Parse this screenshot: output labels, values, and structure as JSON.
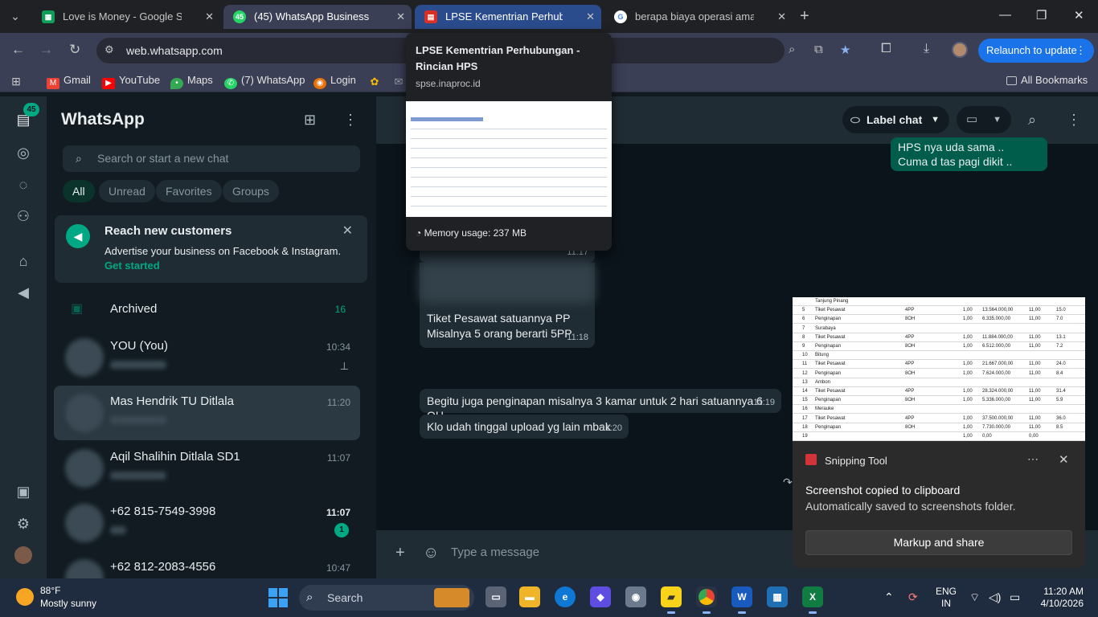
{
  "browser": {
    "tabs": [
      {
        "title": "Love is Money - Google Spread",
        "favicon": "sheets-icon",
        "state": "normal"
      },
      {
        "title": "(45) WhatsApp Business",
        "favicon": "whatsapp-icon",
        "favicon_text": "45",
        "state": "active"
      },
      {
        "title": "LPSE Kementrian Perhubungan",
        "favicon": "pdf-icon",
        "state": "hovered"
      },
      {
        "title": "berapa biaya operasi amandel",
        "favicon": "google-icon",
        "state": "normal"
      }
    ],
    "url": "web.whatsapp.com",
    "relaunch_label": "Relaunch to update",
    "bookmarks": [
      "Gmail",
      "YouTube",
      "Maps",
      "(7) WhatsApp",
      "Login"
    ],
    "all_bookmarks": "All Bookmarks"
  },
  "hover_card": {
    "title": "LPSE Kementrian Perhubungan - Rincian HPS",
    "domain": "spse.inaproc.id",
    "memory": "Memory usage: 237 MB"
  },
  "whatsapp": {
    "rail_badge": "45",
    "title": "WhatsApp",
    "search_placeholder": "Search or start a new chat",
    "filters": [
      "All",
      "Unread",
      "Favorites",
      "Groups"
    ],
    "promo": {
      "title": "Reach new customers",
      "desc": "Advertise your business on Facebook & Instagram.",
      "link": "Get started"
    },
    "archived": {
      "label": "Archived",
      "count": "16"
    },
    "chats": [
      {
        "name": "YOU (You)",
        "time": "10:34",
        "pinned": true,
        "unread": ""
      },
      {
        "name": "Mas Hendrik TU Ditlala",
        "time": "11:20",
        "pinned": false,
        "unread": ""
      },
      {
        "name": "Aqil Shalihin Ditlala SD1",
        "time": "11:07",
        "pinned": false,
        "unread": ""
      },
      {
        "name": "+62 815-7549-3998",
        "time": "11:07",
        "pinned": false,
        "unread": "1"
      },
      {
        "name": "+62 812-2083-4556",
        "time": "10:47",
        "pinned": false,
        "unread": ""
      }
    ],
    "header": {
      "label_chat": "Label chat"
    },
    "messages": [
      {
        "dir": "out",
        "lines": [
          "HPS nya uda sama ..",
          "Cuma d tas pagi dikit .."
        ],
        "time": ""
      },
      {
        "dir": "in",
        "lines": [
          "Tiket Pesawat satuannya PP",
          "Misalnya 5 orang  berarti 5PP"
        ],
        "time": "11:18"
      },
      {
        "dir": "in",
        "lines": [
          "Begitu juga penginapan misalnya 3 kamar untuk 2 hari satuannya 6 OH"
        ],
        "time": "11:19"
      },
      {
        "dir": "in",
        "lines": [
          "Klo udah tinggal upload yg lain mbak"
        ],
        "time": "11:20"
      }
    ],
    "partial_time": "11:17",
    "composer_placeholder": "Type a message"
  },
  "snippet_preview": {
    "rows": [
      {
        "n": "",
        "name": "Tanjung Pinang",
        "unit": "",
        "qty": "",
        "price": "",
        "tax": "",
        "total": ""
      },
      {
        "n": "5",
        "name": "Tiket Pesawat",
        "unit": "4PP",
        "qty": "1,00",
        "price": "13.564.000,00",
        "tax": "11,00",
        "total": "15.0"
      },
      {
        "n": "6",
        "name": "Penginapan",
        "unit": "8OH",
        "qty": "1,00",
        "price": "6.335.000,00",
        "tax": "11,00",
        "total": "7.0"
      },
      {
        "n": "7",
        "name": "Surabaya",
        "unit": "",
        "qty": "",
        "price": "",
        "tax": "",
        "total": ""
      },
      {
        "n": "8",
        "name": "Tiket Pesawat",
        "unit": "4PP",
        "qty": "1,00",
        "price": "11.884.000,00",
        "tax": "11,00",
        "total": "13.1"
      },
      {
        "n": "9",
        "name": "Penginapan",
        "unit": "8OH",
        "qty": "1,00",
        "price": "6.512.000,00",
        "tax": "11,00",
        "total": "7.2"
      },
      {
        "n": "10",
        "name": "Bitung",
        "unit": "",
        "qty": "",
        "price": "",
        "tax": "",
        "total": ""
      },
      {
        "n": "11",
        "name": "Tiket Pesawat",
        "unit": "4PP",
        "qty": "1,00",
        "price": "21.667.000,00",
        "tax": "11,00",
        "total": "24.0"
      },
      {
        "n": "12",
        "name": "Penginapan",
        "unit": "8OH",
        "qty": "1,00",
        "price": "7.624.000,00",
        "tax": "11,00",
        "total": "8.4"
      },
      {
        "n": "13",
        "name": "Ambon",
        "unit": "",
        "qty": "",
        "price": "",
        "tax": "",
        "total": ""
      },
      {
        "n": "14",
        "name": "Tiket Pesawat",
        "unit": "4PP",
        "qty": "1,00",
        "price": "28.324.000,00",
        "tax": "11,00",
        "total": "31.4"
      },
      {
        "n": "15",
        "name": "Penginapan",
        "unit": "8OH",
        "qty": "1,00",
        "price": "5.336.000,00",
        "tax": "11,00",
        "total": "5.9"
      },
      {
        "n": "16",
        "name": "Merauke",
        "unit": "",
        "qty": "",
        "price": "",
        "tax": "",
        "total": ""
      },
      {
        "n": "17",
        "name": "Tiket Pesawat",
        "unit": "4PP",
        "qty": "1,00",
        "price": "37.500.000,00",
        "tax": "11,00",
        "total": "36.0"
      },
      {
        "n": "18",
        "name": "Penginapan",
        "unit": "8OH",
        "qty": "1,00",
        "price": "7.730.000,00",
        "tax": "11,00",
        "total": "8.5"
      },
      {
        "n": "19",
        "name": "",
        "unit": "",
        "qty": "1,00",
        "price": "0,00",
        "tax": "0,00",
        "total": ""
      }
    ]
  },
  "toast": {
    "app": "Snipping Tool",
    "line1": "Screenshot copied to clipboard",
    "line2": "Automatically saved to screenshots folder.",
    "button": "Markup and share"
  },
  "taskbar": {
    "temp": "88°F",
    "weather": "Mostly sunny",
    "search": "Search",
    "lang1": "ENG",
    "lang2": "IN",
    "time": "11:20 AM",
    "date": "4/10/2026"
  }
}
